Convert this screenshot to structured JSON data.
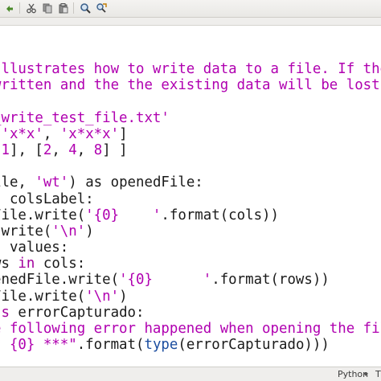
{
  "toolbar": {
    "buttons": [
      {
        "icon": "undo-arrow-icon"
      },
      {
        "icon": "cut-icon"
      },
      {
        "icon": "copy-icon"
      },
      {
        "icon": "paste-icon"
      },
      {
        "icon": "find-icon"
      },
      {
        "icon": "find-replace-icon"
      }
    ]
  },
  "editor": {
    "language": "Python",
    "colors": {
      "string": "#b000b0",
      "keyword": "#a2009c",
      "builtin": "#1c4ea0",
      "text": "#1a1a1a"
    },
    "lines": [
      [
        {
          "t": "str",
          "v": "Illustrates how to write data to a file. If the f"
        }
      ],
      [
        {
          "t": "str",
          "v": "written and the the existing data will be lost"
        }
      ],
      [
        {
          "t": "txt",
          "v": ""
        }
      ],
      [
        {
          "t": "str",
          "v": "_write_test_file.txt'"
        }
      ],
      [
        {
          "t": "txt",
          "v": " "
        },
        {
          "t": "str",
          "v": "'x*x'"
        },
        {
          "t": "txt",
          "v": ", "
        },
        {
          "t": "str",
          "v": "'x*x*x'"
        },
        {
          "t": "txt",
          "v": "]"
        }
      ],
      [
        {
          "t": "txt",
          "v": " "
        },
        {
          "t": "str",
          "v": "1"
        },
        {
          "t": "txt",
          "v": "], ["
        },
        {
          "t": "str",
          "v": "2"
        },
        {
          "t": "txt",
          "v": ", "
        },
        {
          "t": "str",
          "v": "4"
        },
        {
          "t": "txt",
          "v": ", "
        },
        {
          "t": "str",
          "v": "8"
        },
        {
          "t": "txt",
          "v": "] ]"
        }
      ],
      [
        {
          "t": "txt",
          "v": ""
        }
      ],
      [
        {
          "t": "txt",
          "v": "ile, "
        },
        {
          "t": "str",
          "v": "'wt'"
        },
        {
          "t": "txt",
          "v": ") as openedFile:"
        }
      ],
      [
        {
          "t": "kw",
          "v": "n"
        },
        {
          "t": "txt",
          "v": " colsLabel:"
        }
      ],
      [
        {
          "t": "txt",
          "v": "File.write("
        },
        {
          "t": "str",
          "v": "'{0}    '"
        },
        {
          "t": "txt",
          "v": ".format(cols))"
        }
      ],
      [
        {
          "t": "txt",
          "v": ".write("
        },
        {
          "t": "str",
          "v": "'\\n'"
        },
        {
          "t": "txt",
          "v": ")"
        }
      ],
      [
        {
          "t": "kw",
          "v": "n"
        },
        {
          "t": "txt",
          "v": " values:"
        }
      ],
      [
        {
          "t": "txt",
          "v": "ws "
        },
        {
          "t": "kw",
          "v": "in"
        },
        {
          "t": "txt",
          "v": " cols:"
        }
      ],
      [
        {
          "t": "txt",
          "v": "enedFile.write("
        },
        {
          "t": "str",
          "v": "'{0}      '"
        },
        {
          "t": "txt",
          "v": ".format(rows))"
        }
      ],
      [
        {
          "t": "txt",
          "v": "File.write("
        },
        {
          "t": "str",
          "v": "'\\n'"
        },
        {
          "t": "txt",
          "v": ")"
        }
      ],
      [
        {
          "t": "kw",
          "v": "as"
        },
        {
          "t": "txt",
          "v": " errorCapturado:"
        }
      ],
      [
        {
          "t": "str",
          "v": "e following error happened when opening the file"
        }
      ],
      [
        {
          "t": "str",
          "v": "* {0} ***\""
        },
        {
          "t": "txt",
          "v": ".format("
        },
        {
          "t": "fn",
          "v": "type"
        },
        {
          "t": "txt",
          "v": "(errorCapturado)))"
        }
      ]
    ]
  },
  "statusbar": {
    "language": "Python",
    "tab_label": "T"
  }
}
